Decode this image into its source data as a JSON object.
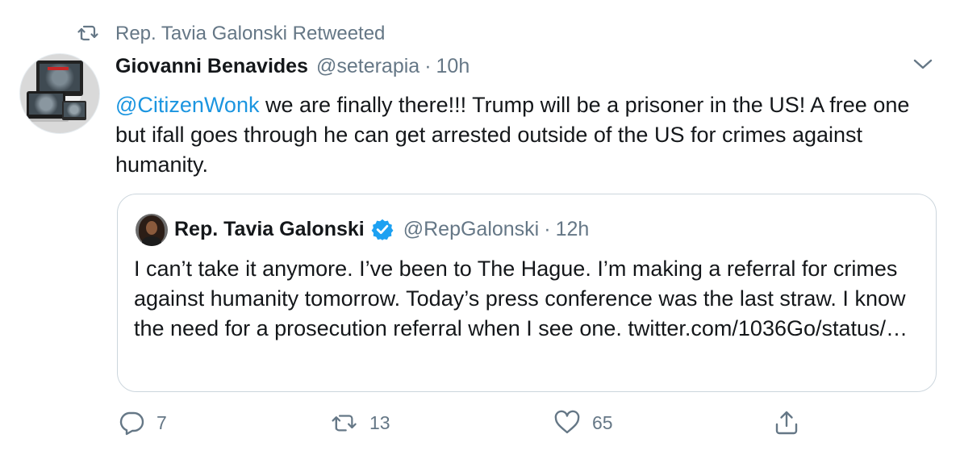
{
  "retweet_header": {
    "text": "Rep. Tavia Galonski Retweeted",
    "icon": "retweet-icon"
  },
  "tweet": {
    "author_name": "Giovanni Benavides",
    "author_handle": "@seterapia",
    "separator": "·",
    "time": "10h",
    "mention": "@CitizenWonk",
    "body": " we are finally there!!! Trump will be a prisoner in the US! A free one but ifall goes through he can get arrested outside of the US for crimes against humanity."
  },
  "quoted_tweet": {
    "author_name": "Rep. Tavia Galonski",
    "verified": true,
    "author_handle": "@RepGalonski",
    "separator": "·",
    "time": "12h",
    "body": "I can’t take it anymore. I’ve been to The Hague. I’m making a referral for crimes against humanity tomorrow. Today’s press conference was the last straw. I know the need for a prosecution referral when I see one. twitter.com/1036Go/status/…"
  },
  "actions": {
    "replies": "7",
    "retweets": "13",
    "likes": "65"
  },
  "colors": {
    "link": "#1b95e0",
    "secondary_text": "#657786",
    "border": "#ccd6dd",
    "verified": "#1da1f2"
  }
}
